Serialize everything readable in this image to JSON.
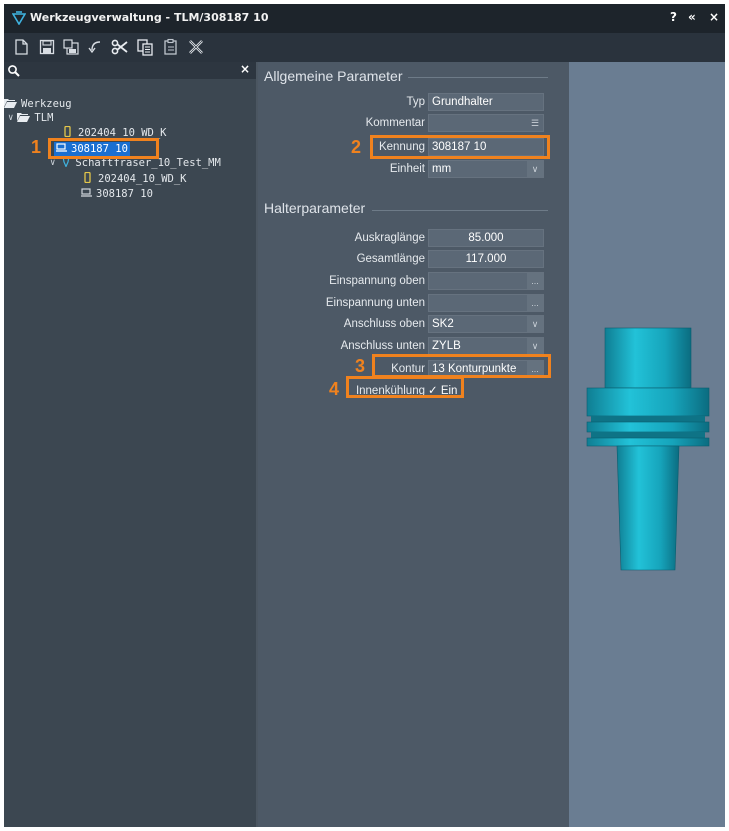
{
  "window": {
    "title": "Werkzeugverwaltung - TLM/308187 10",
    "buttons": {
      "help": "?",
      "collapse": "«",
      "close": "×"
    }
  },
  "toolbar": {
    "icons": [
      "new-file-icon",
      "save-icon",
      "save-as-icon",
      "undo-icon",
      "cut-icon",
      "copy-icon",
      "paste-icon",
      "delete-icon"
    ]
  },
  "search": {
    "icon": "search-icon",
    "clear": "×"
  },
  "tree": {
    "root": "Werkzeug",
    "folder": "TLM",
    "items": [
      {
        "label": "202404_10_WD_K"
      },
      {
        "label": "308187 10"
      },
      {
        "label": "Schaftfräser_10_Test_MM"
      },
      {
        "label": "202404_10_WD_K"
      },
      {
        "label": "308187 10"
      }
    ]
  },
  "general": {
    "title": "Allgemeine Parameter",
    "fields": [
      {
        "label": "Typ",
        "value": "Grundhalter"
      },
      {
        "label": "Kommentar",
        "value": ""
      },
      {
        "label": "Kennung",
        "value": "308187 10"
      },
      {
        "label": "Einheit",
        "value": "mm"
      }
    ]
  },
  "holder": {
    "title": "Halterparameter",
    "fields": [
      {
        "label": "Auskraglänge",
        "value": "85.000"
      },
      {
        "label": "Gesamtlänge",
        "value": "117.000"
      },
      {
        "label": "Einspannung oben",
        "value": ""
      },
      {
        "label": "Einspannung unten",
        "value": ""
      },
      {
        "label": "Anschluss oben",
        "value": "SK2"
      },
      {
        "label": "Anschluss unten",
        "value": "ZYLB"
      },
      {
        "label": "Kontur",
        "value": "13 Konturpunkte"
      },
      {
        "label": "Innenkühlung",
        "value": "✓ Ein"
      }
    ]
  },
  "buttons": {
    "ellipsis": "..."
  },
  "annotations": {
    "n1": "1",
    "n2": "2",
    "n3": "3",
    "n4": "4"
  },
  "colors": {
    "highlight": "#f0821e",
    "selection": "#1a6fd1",
    "tool": "#19a9bf"
  }
}
